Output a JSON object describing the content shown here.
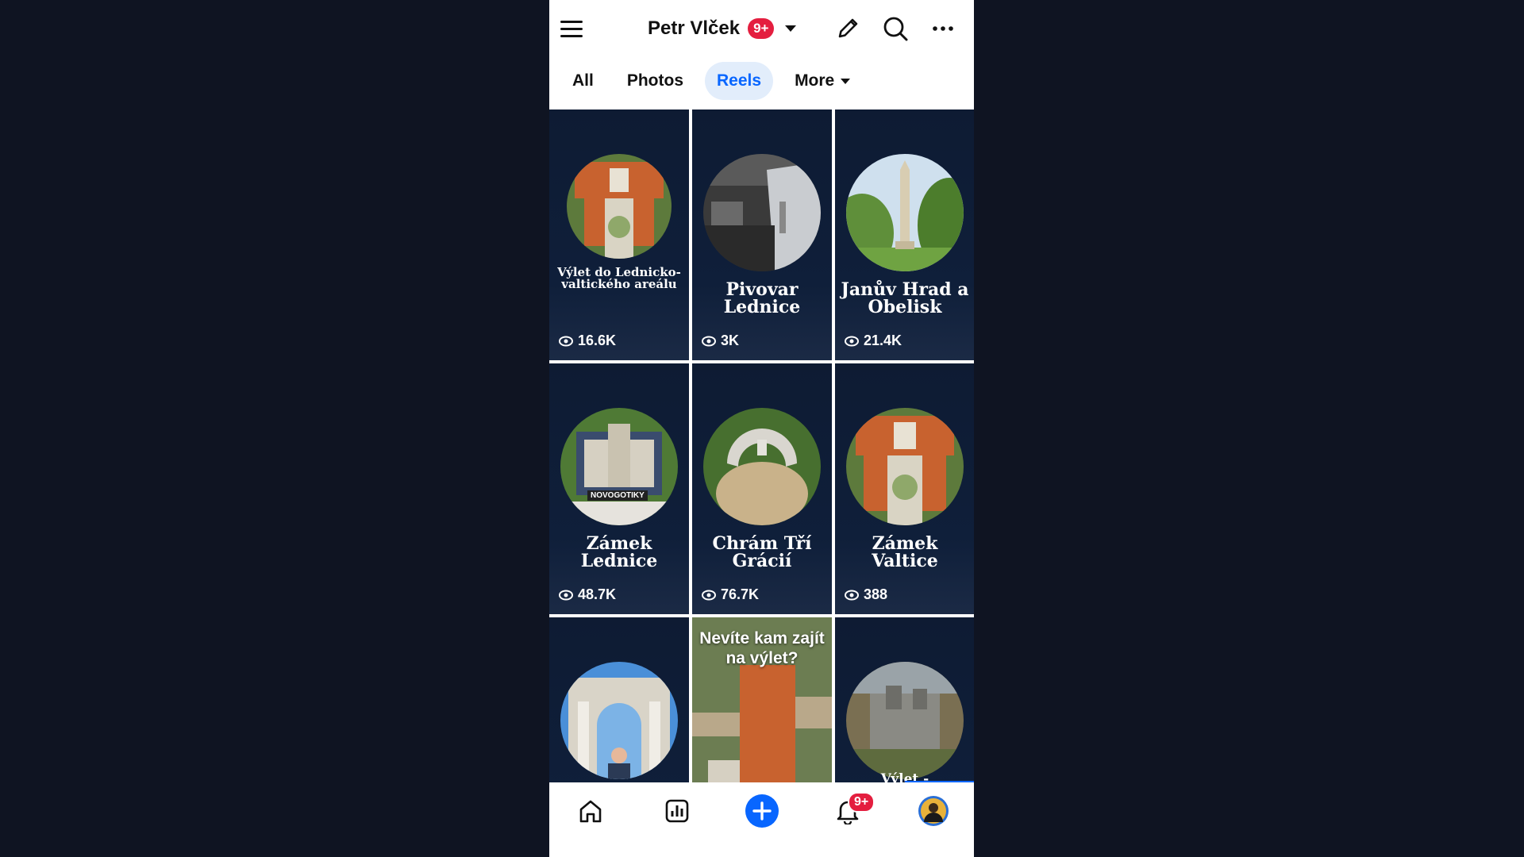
{
  "header": {
    "menu_icon": "hamburger-icon",
    "title": "Petr Vlček",
    "badge": "9+",
    "edit_icon": "pencil-icon",
    "search_icon": "search-icon",
    "more_icon": "ellipsis-icon"
  },
  "tabs": [
    {
      "label": "All",
      "active": false
    },
    {
      "label": "Photos",
      "active": false
    },
    {
      "label": "Reels",
      "active": true
    },
    {
      "label": "More",
      "active": false
    }
  ],
  "reels": [
    {
      "title": "Výlet do Lednicko-valtického areálu",
      "views": "16.6K"
    },
    {
      "title": "Pivovar Lednice",
      "views": "3K"
    },
    {
      "title": "Janův Hrad a Obelisk",
      "views": "21.4K"
    },
    {
      "title": "Zámek Lednice",
      "views": "48.7K",
      "sticker": "NOVOGOTIKY"
    },
    {
      "title": "Chrám Tří Grácií",
      "views": "76.7K"
    },
    {
      "title": "Zámek Valtice",
      "views": "388"
    },
    {
      "title": ""
    },
    {
      "title": "Nevíte kam zajít na výlet?"
    },
    {
      "title": "Výlet -"
    }
  ],
  "bottom_nav": {
    "home_icon": "home-icon",
    "insights_icon": "bar-chart-icon",
    "create_icon": "plus-circle-icon",
    "notifications_icon": "bell-icon",
    "notifications_badge": "9+",
    "profile_icon": "avatar"
  },
  "colors": {
    "accent": "#0866ff",
    "badge": "#e41e3f",
    "tile_bg": "#0f1f3a",
    "page_bg": "#0f1422"
  }
}
